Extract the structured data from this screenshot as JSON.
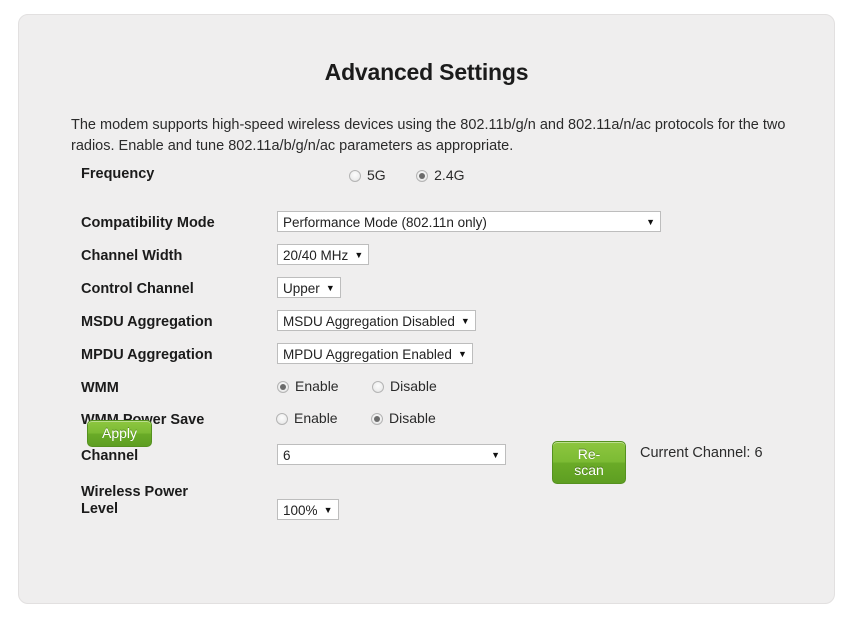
{
  "page": {
    "title": "Advanced Settings",
    "intro": "The modem supports high-speed wireless devices using the 802.11b/g/n and 802.11a/n/ac protocols for the two radios. Enable and tune 802.11a/b/g/n/ac parameters as appropriate.",
    "panel_bg": "#efeeee",
    "accent_green": "#7cbb34"
  },
  "form": {
    "frequency": {
      "label": "Frequency",
      "options": [
        {
          "label": "5G",
          "selected": false
        },
        {
          "label": "2.4G",
          "selected": true
        }
      ]
    },
    "compatibility_mode": {
      "label": "Compatibility Mode",
      "value": "Performance Mode (802.11n only)",
      "arrow": "▼"
    },
    "channel_width": {
      "label": "Channel Width",
      "value": "20/40 MHz",
      "arrow": "▼"
    },
    "control_channel": {
      "label": "Control Channel",
      "value": "Upper",
      "arrow": "▼"
    },
    "msdu_aggregation": {
      "label": "MSDU Aggregation",
      "value": "MSDU Aggregation Disabled",
      "arrow": "▼"
    },
    "mpdu_aggregation": {
      "label": "MPDU Aggregation",
      "value": "MPDU Aggregation Enabled",
      "arrow": "▼"
    },
    "wmm": {
      "label": "WMM",
      "options": [
        {
          "label": "Enable",
          "selected": true
        },
        {
          "label": "Disable",
          "selected": false
        }
      ]
    },
    "wmm_power_save": {
      "label": "WMM Power Save",
      "options": [
        {
          "label": "Enable",
          "selected": false
        },
        {
          "label": "Disable",
          "selected": true
        }
      ]
    },
    "channel": {
      "label": "Channel",
      "value": "6",
      "arrow": "▼",
      "rescan_label": "Re-scan",
      "current_channel_text": "Current Channel: 6"
    },
    "wireless_power_level": {
      "label_line1": "Wireless Power",
      "label_line2": "Level",
      "value": "100%",
      "arrow": "▼"
    },
    "apply_label": "Apply"
  }
}
